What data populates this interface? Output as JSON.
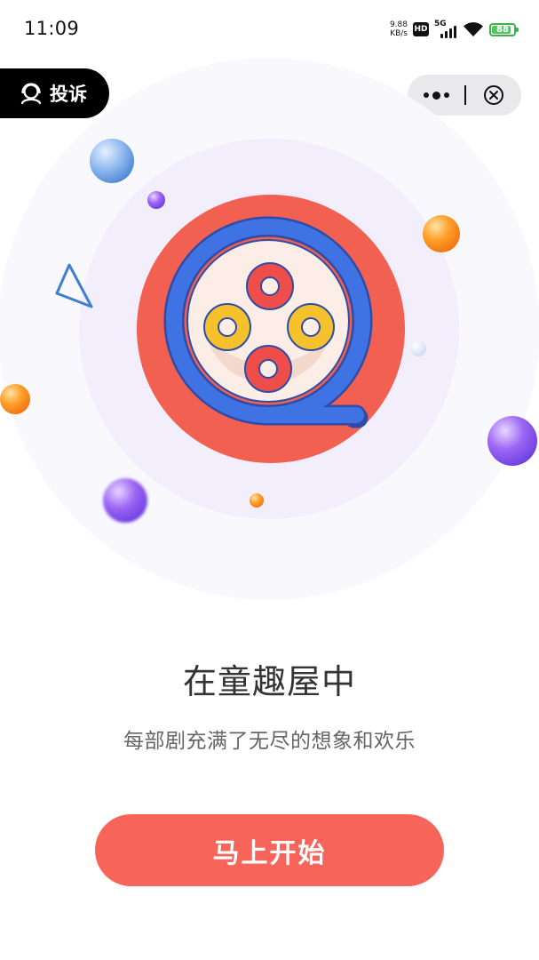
{
  "status_bar": {
    "time": "11:09",
    "net_speed_value": "9.88",
    "net_speed_unit": "KB/s",
    "hd_label": "HD",
    "network_label": "5G",
    "battery_level": "88",
    "battery_fraction": 0.88
  },
  "header": {
    "complaint_label": "投诉",
    "more_icon": "more-dots-icon",
    "close_icon": "close-circle-icon"
  },
  "illustration": {
    "logo_icon": "film-reel-icon"
  },
  "intro": {
    "title": "在童趣屋中",
    "subtitle": "每部剧充满了无尽的想象和欢乐"
  },
  "actions": {
    "start_label": "马上开始"
  },
  "colors": {
    "accent": "#f6645a",
    "logo_red": "#f16050",
    "logo_blue": "#3f73e3",
    "reel_yellow": "#f5c22e",
    "reel_red": "#ef4d4a",
    "soft_purple": "#f6f3fd",
    "button_text": "#ffffff"
  }
}
